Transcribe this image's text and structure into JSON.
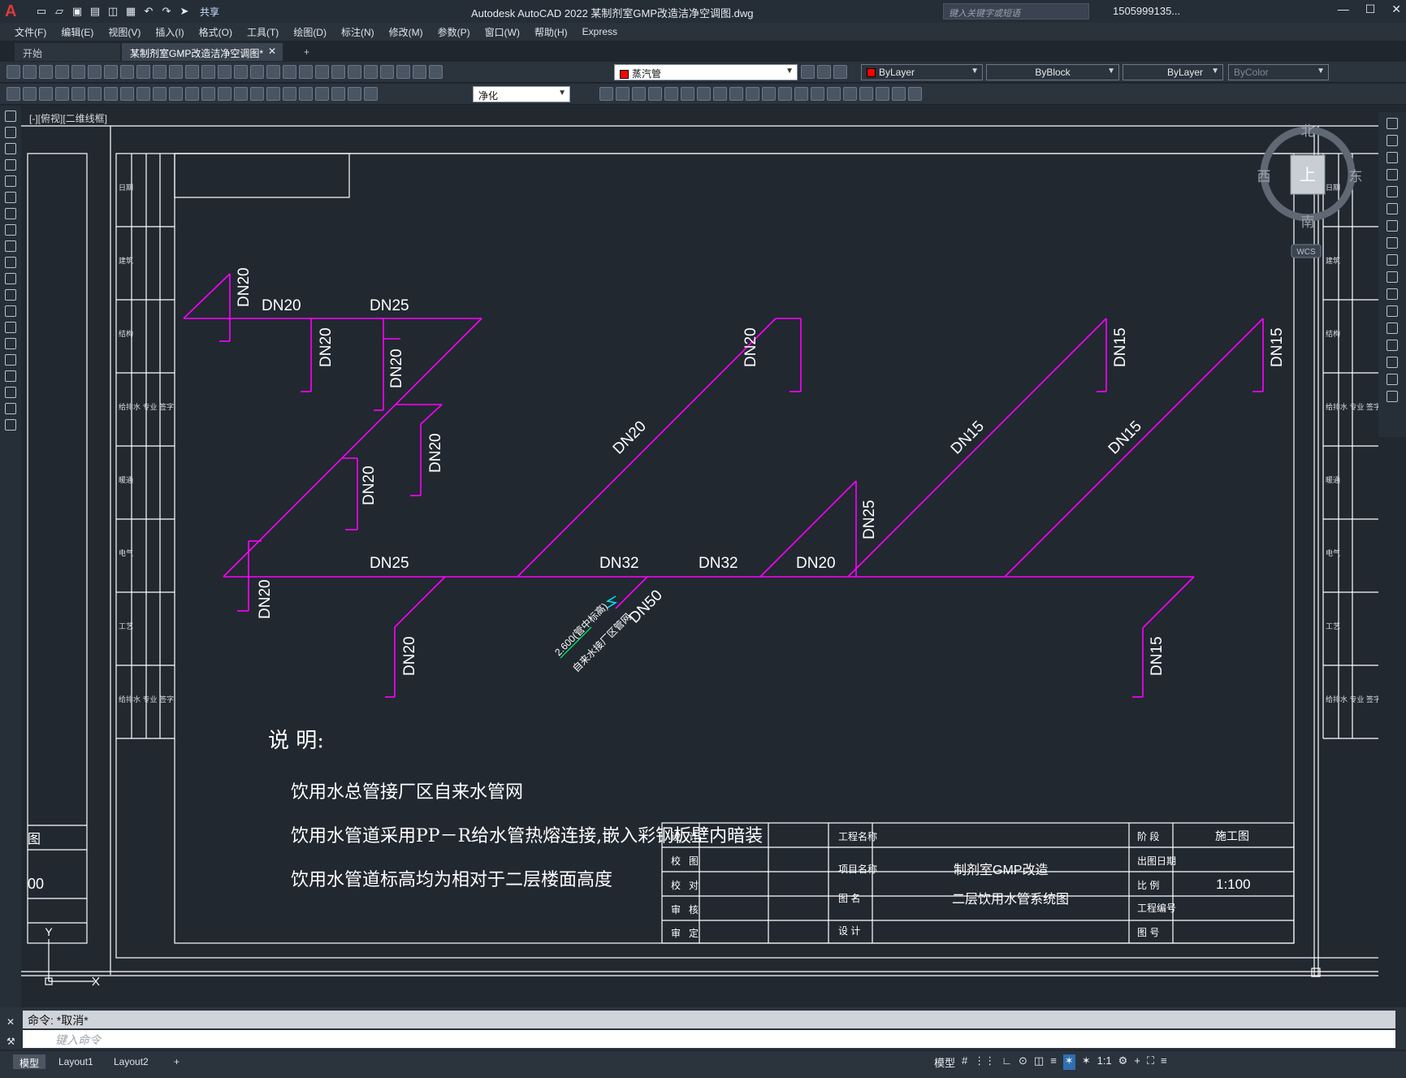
{
  "app": {
    "logo_letter": "A",
    "share_label": "共享",
    "title": "Autodesk AutoCAD 2022    某制剂室GMP改造洁净空调图.dwg",
    "search_placeholder": "键入关键字或短语",
    "user": "1505999135...",
    "window_controls": [
      "—",
      "☐",
      "✕"
    ]
  },
  "menu": [
    "文件(F)",
    "编辑(E)",
    "视图(V)",
    "插入(I)",
    "格式(O)",
    "工具(T)",
    "绘图(D)",
    "标注(N)",
    "修改(M)",
    "参数(P)",
    "窗口(W)",
    "帮助(H)",
    "Express"
  ],
  "tabs": {
    "start": "开始",
    "active": "某制剂室GMP改造洁净空调图*",
    "close": "✕",
    "add": "+"
  },
  "toolbar": {
    "layer": "蒸汽管",
    "color": "ByLayer",
    "linetype": "ByBlock",
    "lineweight": "ByLayer",
    "plotstyle": "ByColor",
    "textstyle": "净化"
  },
  "colors": {
    "pipe": "#ff00ff",
    "frame": "#ffffff",
    "canvas": "#212830",
    "note": "#00ff66",
    "break": "#00e5ff"
  },
  "viewcube": {
    "north": "北",
    "south": "南",
    "east": "东",
    "west": "西",
    "top": "上",
    "ucs": "WCS"
  },
  "view_label": "[-][俯视][二维线框]",
  "drawing": {
    "pipe_labels": [
      "DN20",
      "DN25",
      "DN20",
      "DN20",
      "DN20",
      "DN20",
      "DN20",
      "DN15",
      "DN15",
      "DN20",
      "DN15",
      "DN15",
      "DN20",
      "DN25",
      "DN25",
      "DN32",
      "DN32",
      "DN20",
      "DN20",
      "DN50",
      "DN20",
      "DN15"
    ],
    "inlet_elev": "2.600(管中标高)",
    "inlet_note": "自来水接厂区管网",
    "notes_title": "说    明:",
    "notes": [
      "饮用水总管接厂区自来水管网",
      "饮用水管道采用PP－R给水管热熔连接,嵌入彩钢板壁内暗装",
      "饮用水管道标高均为相对于二层楼面高度"
    ],
    "left_fragment": {
      "a": "图",
      "b": "00",
      "axis": "Y"
    },
    "sidebar_cells": [
      "日期",
      "建筑",
      "结构",
      "给排水 专业 签字",
      "暖通",
      "电气",
      "工艺",
      "给排水 专业 签字"
    ]
  },
  "titleblock": {
    "left": [
      [
        "设",
        "计"
      ],
      [
        "校",
        "图"
      ],
      [
        "校",
        "对"
      ],
      [
        "审",
        "核"
      ],
      [
        "审",
        "定"
      ]
    ],
    "project_label": "工程名称",
    "item_label": "项目名称",
    "item_value": "制剂室GMP改造",
    "drawing_label": "图    名",
    "drawing_value": "二层饮用水管系统图",
    "design_label": "设    计",
    "stage_label": "阶    段",
    "stage_value": "施工图",
    "date_label": "出图日期",
    "scale_label": "比    例",
    "scale_value": "1:100",
    "projno_label": "工程编号",
    "sheet_label": "图    号"
  },
  "command": {
    "history": "命令: *取消*",
    "placeholder": "键入命令"
  },
  "status": {
    "model": "模型",
    "layout1": "Layout1",
    "layout2": "Layout2",
    "add": "+",
    "model_btn": "模型",
    "scale": "1:1"
  }
}
